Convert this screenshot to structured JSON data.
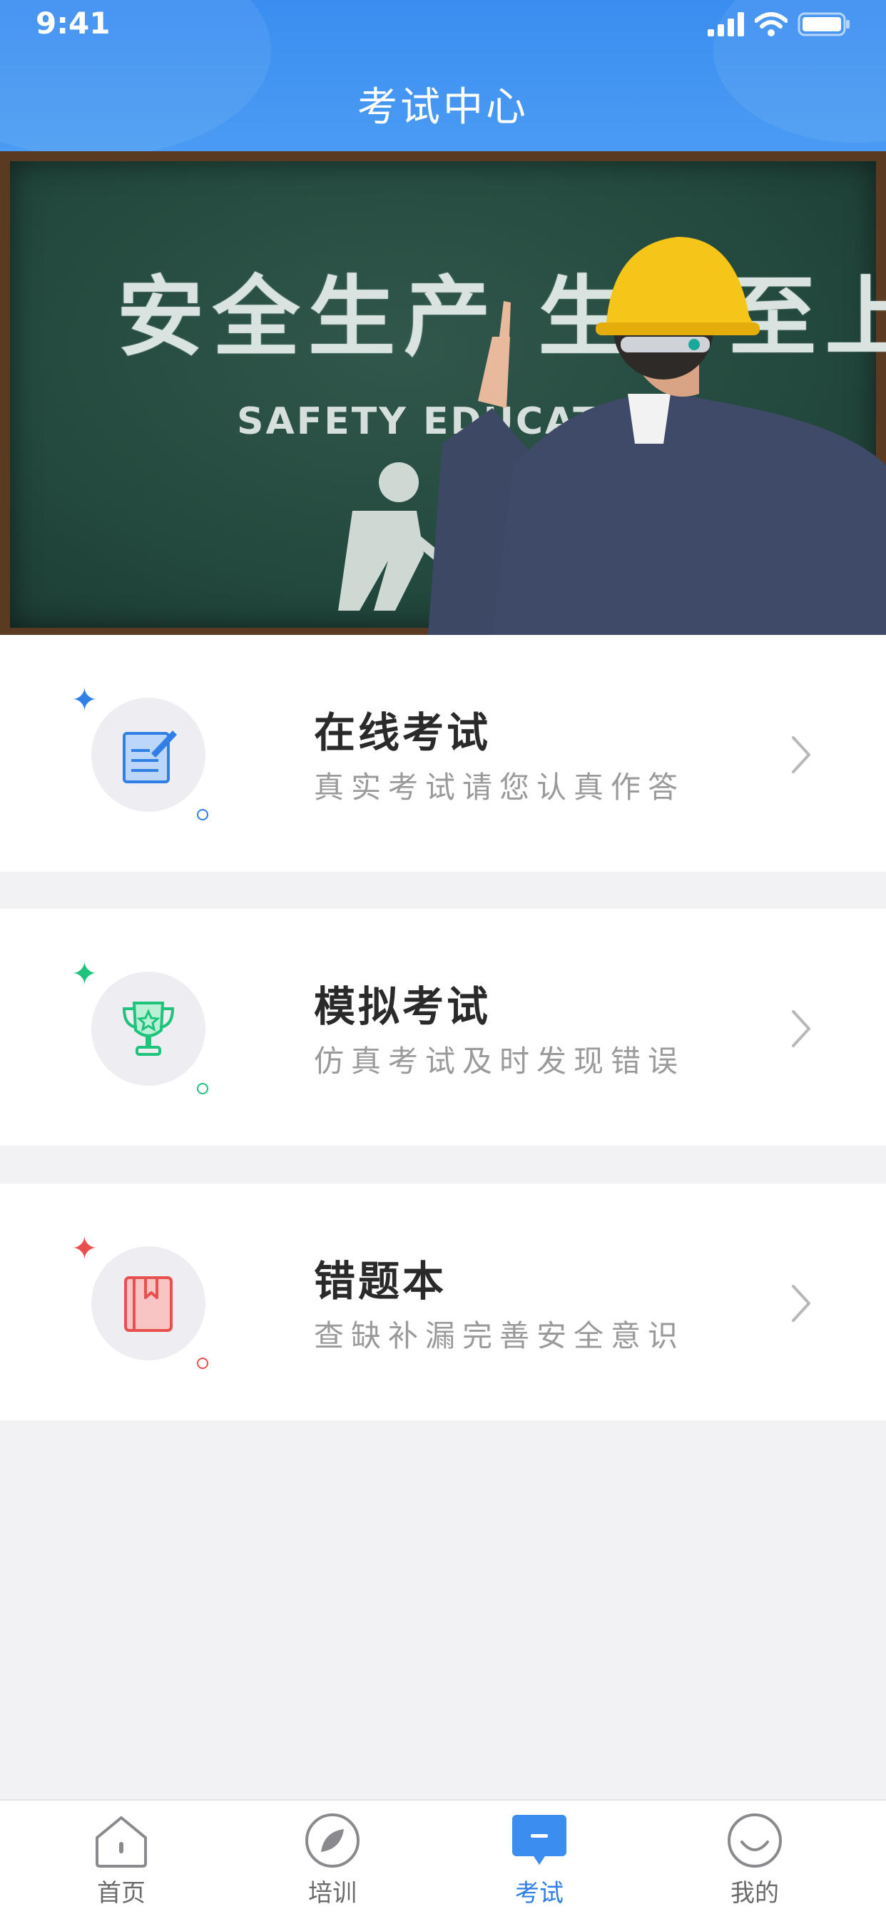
{
  "status_bar": {
    "time": "9:41"
  },
  "header": {
    "title": "考试中心"
  },
  "banner": {
    "headline": "安全生产  生命至上",
    "subtitle": "SAFETY EDUCATION"
  },
  "menu": [
    {
      "title": "在线考试",
      "subtitle": "真实考试请您认真作答",
      "icon": "exam-form-icon",
      "accent": "#2f7fe6"
    },
    {
      "title": "模拟考试",
      "subtitle": "仿真考试及时发现错误",
      "icon": "trophy-icon",
      "accent": "#1ec37c"
    },
    {
      "title": "错题本",
      "subtitle": "查缺补漏完善安全意识",
      "icon": "bookmark-book-icon",
      "accent": "#e8504f"
    }
  ],
  "tabbar": {
    "items": [
      {
        "label": "首页",
        "icon": "home-icon"
      },
      {
        "label": "培训",
        "icon": "compass-leaf-icon"
      },
      {
        "label": "考试",
        "icon": "exam-icon",
        "active": true
      },
      {
        "label": "我的",
        "icon": "smile-icon"
      }
    ],
    "active_color": "#2f7fe6"
  }
}
